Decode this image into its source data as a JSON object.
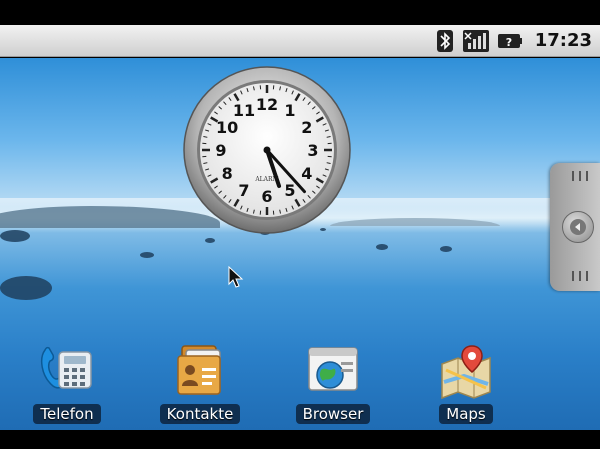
{
  "status_bar": {
    "time": "17:23",
    "icons": [
      "bluetooth-icon",
      "signal-no-sim-icon",
      "battery-unknown-icon"
    ]
  },
  "clock_widget": {
    "numerals": [
      "12",
      "1",
      "2",
      "3",
      "4",
      "5",
      "6",
      "7",
      "8",
      "9",
      "10",
      "11"
    ],
    "brand": "ALARM",
    "hour": 17,
    "minute": 23
  },
  "dock": [
    {
      "label": "Telefon",
      "icon": "phone-icon"
    },
    {
      "label": "Kontakte",
      "icon": "contacts-icon"
    },
    {
      "label": "Browser",
      "icon": "browser-icon"
    },
    {
      "label": "Maps",
      "icon": "maps-icon"
    }
  ],
  "colors": {
    "statusbar": "#d9d9d9",
    "sky": "#2f8fd8",
    "water": "#2a7fc8",
    "label_bg": "#0a192d"
  }
}
